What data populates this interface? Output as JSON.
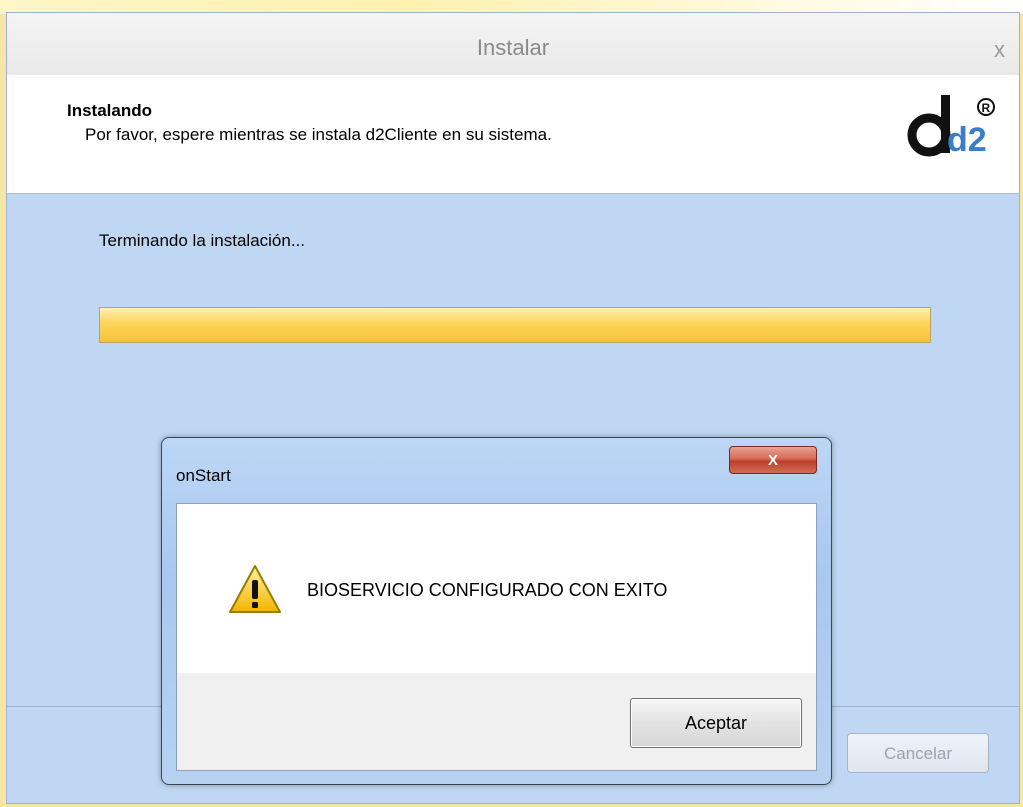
{
  "installer": {
    "title": "Instalar",
    "close_glyph": "x",
    "header_title": "Instalando",
    "header_subtitle": "Por favor, espere mientras se instala d2Cliente en su sistema.",
    "logo": {
      "text": "d2",
      "mark": "R"
    },
    "status_text": "Terminando la instalación...",
    "progress_fraction": 1.0,
    "cancel_label": "Cancelar"
  },
  "dialog": {
    "title": "onStart",
    "close_glyph": "X",
    "message": "BIOSERVICIO CONFIGURADO CON EXITO",
    "icon": "warning-icon",
    "ok_label": "Aceptar"
  },
  "colors": {
    "window_bg": "#bfd7f2",
    "progress_fill": "#ffd45a",
    "close_button_red": "#c84c37"
  }
}
